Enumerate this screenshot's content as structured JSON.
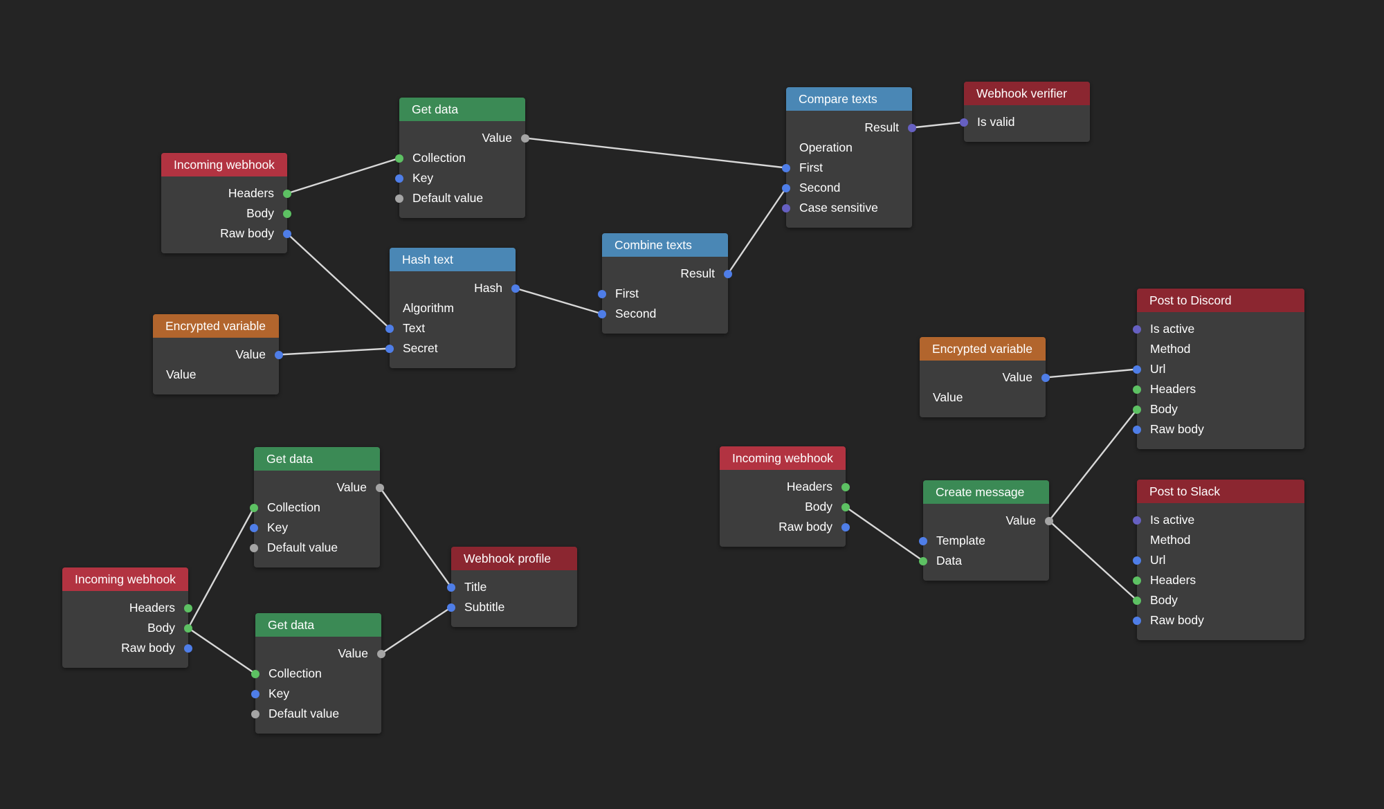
{
  "colors": {
    "background": "#242424",
    "node_body": "#3d3d3d",
    "wire": "#d8d8d8",
    "headers": {
      "red": "#b23341",
      "darkred": "#8b2630",
      "green": "#3b8a55",
      "blue": "#4a87b5",
      "orange": "#b2652d"
    },
    "ports": {
      "green": "#5dc163",
      "blue": "#4f7ee8",
      "gray": "#a5a5a5",
      "purple": "#6660c2"
    }
  },
  "nodes": [
    {
      "id": "incoming-webhook-1",
      "title": "Incoming webhook",
      "color": "red",
      "rows": [
        {
          "label": "Headers",
          "side": "out",
          "port": "green"
        },
        {
          "label": "Body",
          "side": "out",
          "port": "green"
        },
        {
          "label": "Raw body",
          "side": "out",
          "port": "blue"
        }
      ]
    },
    {
      "id": "get-data-1",
      "title": "Get data",
      "color": "green",
      "rows": [
        {
          "label": "Value",
          "side": "out",
          "port": "gray"
        },
        {
          "label": "Collection",
          "side": "in",
          "port": "green"
        },
        {
          "label": "Key",
          "side": "in",
          "port": "blue"
        },
        {
          "label": "Default value",
          "side": "in",
          "port": "gray"
        }
      ]
    },
    {
      "id": "hash-text",
      "title": "Hash text",
      "color": "blue",
      "rows": [
        {
          "label": "Hash",
          "side": "out",
          "port": "blue"
        },
        {
          "label": "Algorithm",
          "side": "none",
          "port": ""
        },
        {
          "label": "Text",
          "side": "in",
          "port": "blue"
        },
        {
          "label": "Secret",
          "side": "in",
          "port": "blue"
        }
      ]
    },
    {
      "id": "encrypted-variable-1",
      "title": "Encrypted variable",
      "color": "orange",
      "rows": [
        {
          "label": "Value",
          "side": "out",
          "port": "blue"
        },
        {
          "label": "Value",
          "side": "none",
          "port": ""
        }
      ]
    },
    {
      "id": "combine-texts",
      "title": "Combine texts",
      "color": "blue",
      "rows": [
        {
          "label": "Result",
          "side": "out",
          "port": "blue"
        },
        {
          "label": "First",
          "side": "in",
          "port": "blue"
        },
        {
          "label": "Second",
          "side": "in",
          "port": "blue"
        }
      ]
    },
    {
      "id": "compare-texts",
      "title": "Compare texts",
      "color": "blue",
      "rows": [
        {
          "label": "Result",
          "side": "out",
          "port": "purple"
        },
        {
          "label": "Operation",
          "side": "none",
          "port": ""
        },
        {
          "label": "First",
          "side": "in",
          "port": "blue"
        },
        {
          "label": "Second",
          "side": "in",
          "port": "blue"
        },
        {
          "label": "Case sensitive",
          "side": "in",
          "port": "purple"
        }
      ]
    },
    {
      "id": "webhook-verifier",
      "title": "Webhook verifier",
      "color": "darkred",
      "rows": [
        {
          "label": "Is valid",
          "side": "in",
          "port": "purple"
        }
      ]
    },
    {
      "id": "get-data-2",
      "title": "Get data",
      "color": "green",
      "rows": [
        {
          "label": "Value",
          "side": "out",
          "port": "gray"
        },
        {
          "label": "Collection",
          "side": "in",
          "port": "green"
        },
        {
          "label": "Key",
          "side": "in",
          "port": "blue"
        },
        {
          "label": "Default value",
          "side": "in",
          "port": "gray"
        }
      ]
    },
    {
      "id": "incoming-webhook-2",
      "title": "Incoming webhook",
      "color": "red",
      "rows": [
        {
          "label": "Headers",
          "side": "out",
          "port": "green"
        },
        {
          "label": "Body",
          "side": "out",
          "port": "green"
        },
        {
          "label": "Raw body",
          "side": "out",
          "port": "blue"
        }
      ]
    },
    {
      "id": "get-data-3",
      "title": "Get data",
      "color": "green",
      "rows": [
        {
          "label": "Value",
          "side": "out",
          "port": "gray"
        },
        {
          "label": "Collection",
          "side": "in",
          "port": "green"
        },
        {
          "label": "Key",
          "side": "in",
          "port": "blue"
        },
        {
          "label": "Default value",
          "side": "in",
          "port": "gray"
        }
      ]
    },
    {
      "id": "webhook-profile",
      "title": "Webhook profile",
      "color": "darkred",
      "rows": [
        {
          "label": "Title",
          "side": "in",
          "port": "blue"
        },
        {
          "label": "Subtitle",
          "side": "in",
          "port": "blue"
        }
      ]
    },
    {
      "id": "incoming-webhook-3",
      "title": "Incoming webhook",
      "color": "red",
      "rows": [
        {
          "label": "Headers",
          "side": "out",
          "port": "green"
        },
        {
          "label": "Body",
          "side": "out",
          "port": "green"
        },
        {
          "label": "Raw body",
          "side": "out",
          "port": "blue"
        }
      ]
    },
    {
      "id": "create-message",
      "title": "Create message",
      "color": "green",
      "rows": [
        {
          "label": "Value",
          "side": "out",
          "port": "gray"
        },
        {
          "label": "Template",
          "side": "in",
          "port": "blue"
        },
        {
          "label": "Data",
          "side": "in",
          "port": "green"
        }
      ]
    },
    {
      "id": "encrypted-variable-2",
      "title": "Encrypted variable",
      "color": "orange",
      "rows": [
        {
          "label": "Value",
          "side": "out",
          "port": "blue"
        },
        {
          "label": "Value",
          "side": "none",
          "port": ""
        }
      ]
    },
    {
      "id": "post-to-discord",
      "title": "Post to Discord",
      "color": "darkred",
      "wide": true,
      "rows": [
        {
          "label": "Is active",
          "side": "in",
          "port": "purple"
        },
        {
          "label": "Method",
          "side": "none",
          "port": ""
        },
        {
          "label": "Url",
          "side": "in",
          "port": "blue"
        },
        {
          "label": "Headers",
          "side": "in",
          "port": "green"
        },
        {
          "label": "Body",
          "side": "in",
          "port": "green"
        },
        {
          "label": "Raw body",
          "side": "in",
          "port": "blue"
        }
      ]
    },
    {
      "id": "post-to-slack",
      "title": "Post to Slack",
      "color": "darkred",
      "wide": true,
      "rows": [
        {
          "label": "Is active",
          "side": "in",
          "port": "purple"
        },
        {
          "label": "Method",
          "side": "none",
          "port": ""
        },
        {
          "label": "Url",
          "side": "in",
          "port": "blue"
        },
        {
          "label": "Headers",
          "side": "in",
          "port": "green"
        },
        {
          "label": "Body",
          "side": "in",
          "port": "green"
        },
        {
          "label": "Raw body",
          "side": "in",
          "port": "blue"
        }
      ]
    }
  ],
  "connections": [
    [
      "incoming-webhook-1",
      0,
      "get-data-1",
      1
    ],
    [
      "incoming-webhook-1",
      2,
      "hash-text",
      2
    ],
    [
      "encrypted-variable-1",
      0,
      "hash-text",
      3
    ],
    [
      "get-data-1",
      0,
      "compare-texts",
      2
    ],
    [
      "hash-text",
      0,
      "combine-texts",
      2
    ],
    [
      "combine-texts",
      0,
      "compare-texts",
      3
    ],
    [
      "compare-texts",
      0,
      "webhook-verifier",
      0
    ],
    [
      "incoming-webhook-2",
      1,
      "get-data-2",
      1
    ],
    [
      "incoming-webhook-2",
      1,
      "get-data-3",
      1
    ],
    [
      "get-data-2",
      0,
      "webhook-profile",
      0
    ],
    [
      "get-data-3",
      0,
      "webhook-profile",
      1
    ],
    [
      "incoming-webhook-3",
      1,
      "create-message",
      2
    ],
    [
      "encrypted-variable-2",
      0,
      "post-to-discord",
      2
    ],
    [
      "create-message",
      0,
      "post-to-discord",
      4
    ],
    [
      "create-message",
      0,
      "post-to-slack",
      4
    ]
  ]
}
